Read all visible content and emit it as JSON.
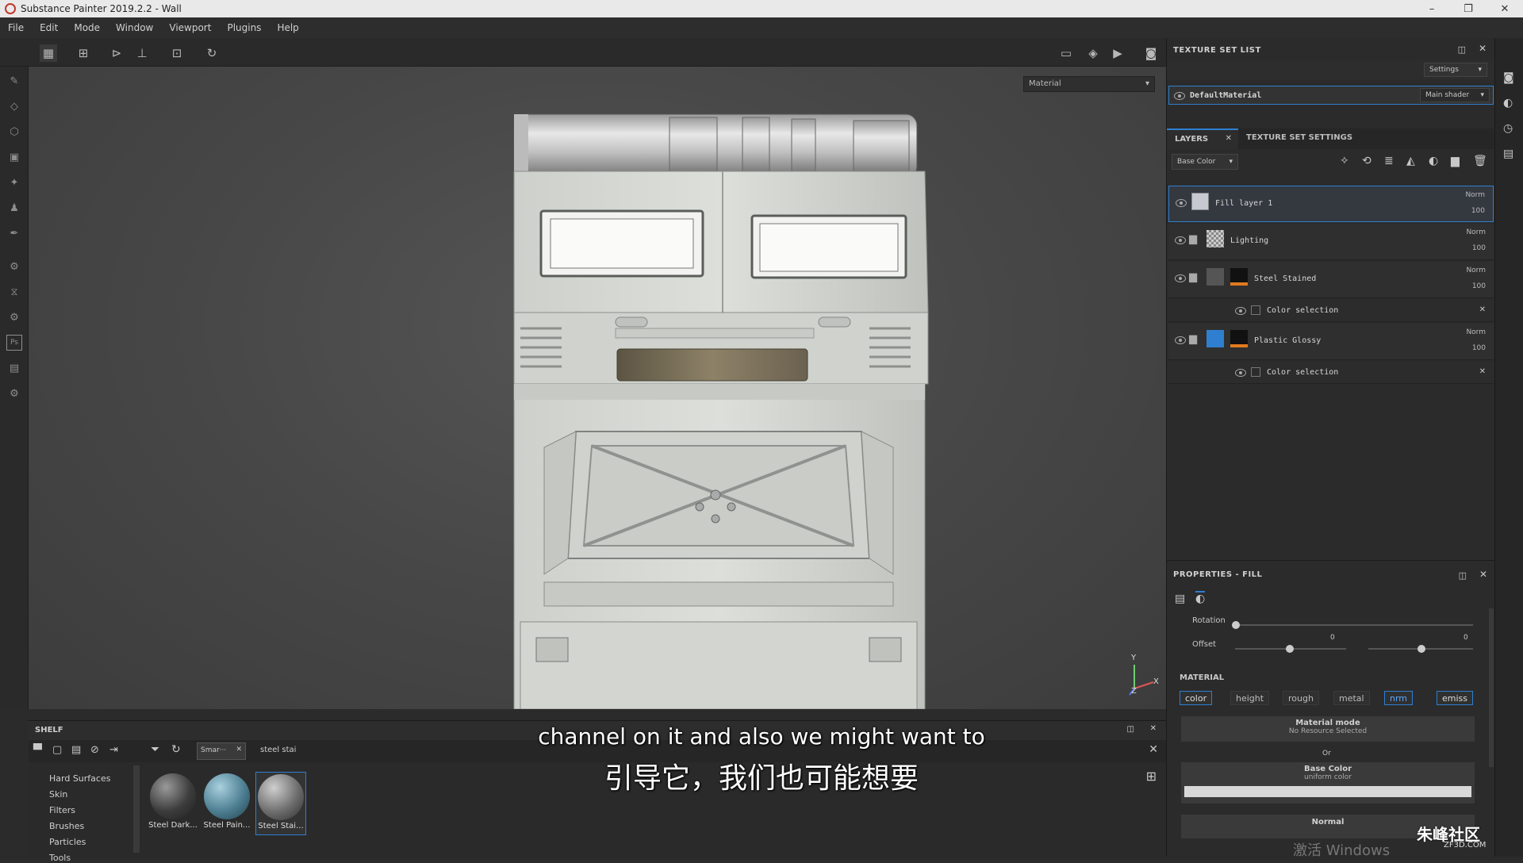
{
  "window": {
    "title": "Substance Painter 2019.2.2 - Wall",
    "buttons": [
      "–",
      "❐",
      "✕"
    ]
  },
  "menu": [
    "File",
    "Edit",
    "Mode",
    "Window",
    "Viewport",
    "Plugins",
    "Help"
  ],
  "viewport": {
    "mode_select": "Material",
    "axis_y": "Y",
    "axis_x": "X",
    "axis_z": "Z"
  },
  "texture_set_list": {
    "title": "TEXTURE SET LIST",
    "settings": "Settings",
    "material": "DefaultMaterial",
    "shader": "Main shader"
  },
  "layers": {
    "tabs": [
      "LAYERS",
      "TEXTURE SET SETTINGS"
    ],
    "channel": "Base Color",
    "items": [
      {
        "name": "Fill layer 1",
        "blend": "Norm",
        "opacity": "100"
      },
      {
        "name": "Lighting",
        "blend": "Norm",
        "opacity": "100"
      },
      {
        "name": "Steel Stained",
        "blend": "Norm",
        "opacity": "100"
      },
      {
        "name": "Color selection"
      },
      {
        "name": "Plastic Glossy",
        "blend": "Norm",
        "opacity": "100"
      },
      {
        "name": "Color selection"
      }
    ]
  },
  "properties": {
    "title": "PROPERTIES - FILL",
    "rotation_label": "Rotation",
    "offset_label": "Offset",
    "offset_values": [
      "0",
      "0"
    ],
    "material_section": "MATERIAL",
    "channels": [
      "color",
      "height",
      "rough",
      "metal",
      "nrm",
      "emiss"
    ],
    "material_mode": "Material mode",
    "no_resource": "No Resource Selected",
    "or": "Or",
    "base_color": "Base Color",
    "uniform_color": "uniform color",
    "normal": "Normal"
  },
  "shelf": {
    "title": "SHELF",
    "filter_tag": "Smar···",
    "search": "steel stai",
    "categories": [
      "Hard Surfaces",
      "Skin",
      "Filters",
      "Brushes",
      "Particles",
      "Tools"
    ],
    "materials": [
      "Steel Dark...",
      "Steel Pain...",
      "Steel Stai..."
    ]
  },
  "subtitles": {
    "en": "channel on it and also we might want to",
    "zh": "引导它，我们也可能想要"
  },
  "watermark": {
    "logo": "朱峰社区",
    "url": "ZF3D.COM",
    "activate": "激活 Windows"
  },
  "colors": {
    "accent": "#2f7fd0",
    "selected_layer": "#2f6fb5"
  }
}
